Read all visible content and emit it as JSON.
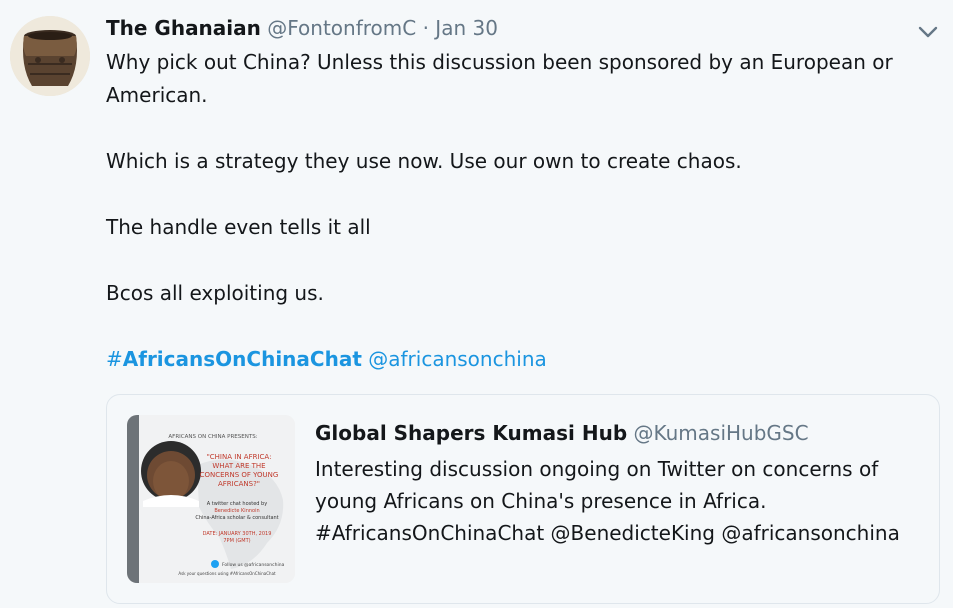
{
  "tweet": {
    "display_name": "The Ghanaian",
    "handle": "@FontonfromC",
    "separator": "·",
    "date": "Jan 30",
    "lines": {
      "l1": "Why pick out China? Unless this discussion been sponsored by an European or",
      "l2": "American.",
      "l3": "Which is a strategy they use now. Use our own to create chaos.",
      "l4": "The handle even tells it all",
      "l5": "Bcos all exploiting us."
    },
    "hashtag_symbol": "#",
    "hashtag": "AfricansOnChinaChat",
    "mention": "@africansonchina"
  },
  "quote": {
    "display_name": "Global Shapers Kumasi Hub",
    "handle": "@KumasiHubGSC",
    "line1": "Interesting discussion ongoing on Twitter on concerns of",
    "line2": "young Africans on China's presence in Africa.",
    "line3": "#AfricansOnChinaChat @BenedicteKing @africansonchina",
    "image": {
      "kicker": "AFRICANS ON CHINA PRESENTS:",
      "headline": [
        "\"CHINA IN AFRICA:",
        "WHAT ARE THE",
        "CONCERNS OF YOUNG",
        "AFRICANS?\""
      ],
      "host_lines": [
        "A twitter chat hosted by",
        "Benedicte Kinnoin",
        "China-Africa scholar & consultant"
      ],
      "date_lines": [
        "DATE: JANUARY 30TH, 2019",
        "7PM (GMT)"
      ],
      "follow": "Follow us @africansonchina",
      "ask": "Ask your questions using #AfricansOnChinaChat"
    }
  },
  "colors": {
    "background": "#f5f8fa",
    "link": "#1b95e0",
    "secondary_text": "#657786",
    "poster_accent": "#c0392b"
  },
  "icons": {
    "menu": "chevron-down-icon",
    "poster_follow": "twitter-bird-icon"
  }
}
